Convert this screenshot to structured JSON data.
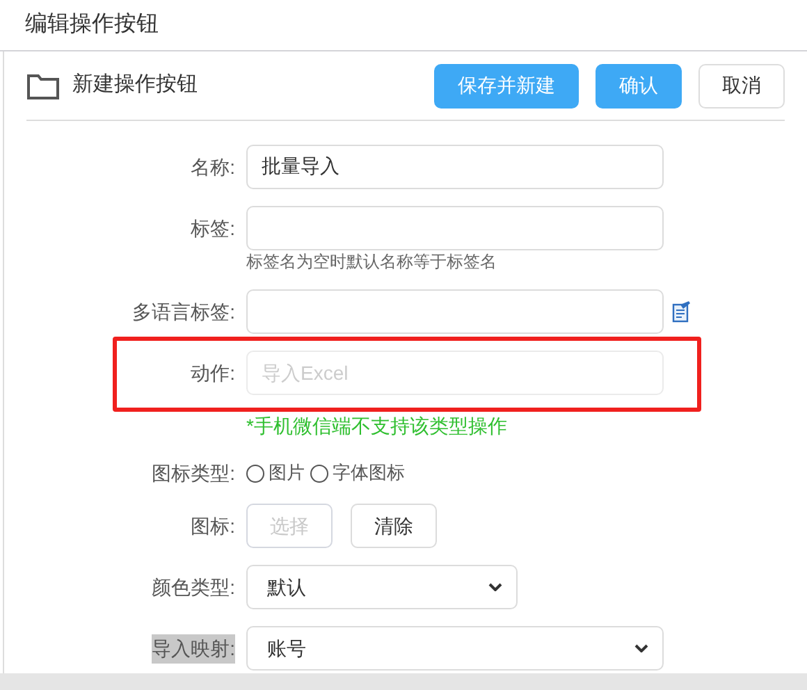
{
  "window": {
    "title": "编辑操作按钮"
  },
  "toolbar": {
    "title": "新建操作按钮",
    "buttons": [
      {
        "label": "保存并新建",
        "kind": "primary"
      },
      {
        "label": "确认",
        "kind": "primary"
      },
      {
        "label": "取消",
        "kind": "default"
      }
    ]
  },
  "fields": [
    {
      "kind": "text",
      "label": "名称:",
      "value": "批量导入"
    },
    {
      "kind": "text",
      "label": "标签:",
      "hint": "标签名为空时默认名称等于标签名"
    },
    {
      "kind": "text",
      "label": "多语言标签:",
      "icon": true
    },
    {
      "kind": "text",
      "label": "动作:",
      "placeholder": "导入Excel",
      "disabled": true,
      "highlighted": true,
      "note": "*手机微信端不支持该类型操作"
    },
    {
      "kind": "radio",
      "label": "图标类型:",
      "options": [
        {
          "label": "图片",
          "selected": false
        },
        {
          "label": "字体图标",
          "selected": false
        }
      ]
    },
    {
      "kind": "buttons",
      "label": "图标:",
      "buttons": [
        {
          "label": "选择",
          "disabled": true
        },
        {
          "label": "清除",
          "disabled": false
        }
      ]
    },
    {
      "kind": "select",
      "label": "颜色类型:",
      "value": "默认",
      "compact": true
    },
    {
      "kind": "select",
      "label": "导入映射:",
      "value": "账号",
      "compact": false,
      "label_selected": true
    }
  ]
}
